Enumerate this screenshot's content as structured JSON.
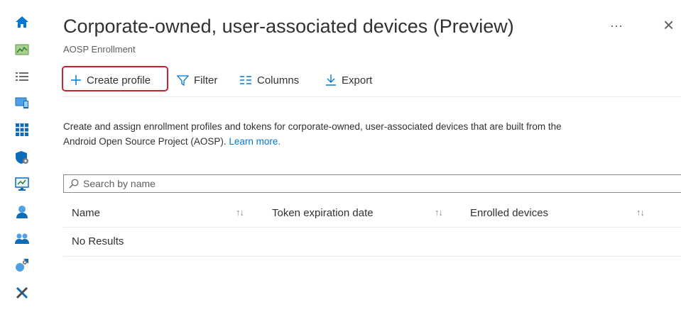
{
  "nav": {
    "items": [
      {
        "name": "home-icon"
      },
      {
        "name": "dashboard-icon"
      },
      {
        "name": "all-services-icon"
      },
      {
        "name": "devices-icon"
      },
      {
        "name": "apps-icon"
      },
      {
        "name": "endpoint-security-icon"
      },
      {
        "name": "reports-icon"
      },
      {
        "name": "users-icon"
      },
      {
        "name": "groups-icon"
      },
      {
        "name": "tenant-administration-icon"
      },
      {
        "name": "troubleshooting-icon"
      }
    ]
  },
  "header": {
    "title": "Corporate-owned, user-associated devices (Preview)",
    "subtitle": "AOSP Enrollment",
    "more": "···",
    "close": "×"
  },
  "toolbar": {
    "create_profile": "Create profile",
    "filter": "Filter",
    "columns": "Columns",
    "export": "Export"
  },
  "description": {
    "line1": "Create and assign enrollment profiles and tokens for corporate-owned, user-associated devices that are built from the",
    "line2": "Android Open Source Project (AOSP).",
    "learn_more": "Learn more."
  },
  "search": {
    "placeholder": "Search by name"
  },
  "table": {
    "columns": [
      "Name",
      "Token expiration date",
      "Enrolled devices"
    ],
    "sort_glyph": "↑↓",
    "empty_text": "No Results"
  },
  "colors": {
    "accent": "#0078d4",
    "highlight": "#c4262e"
  }
}
